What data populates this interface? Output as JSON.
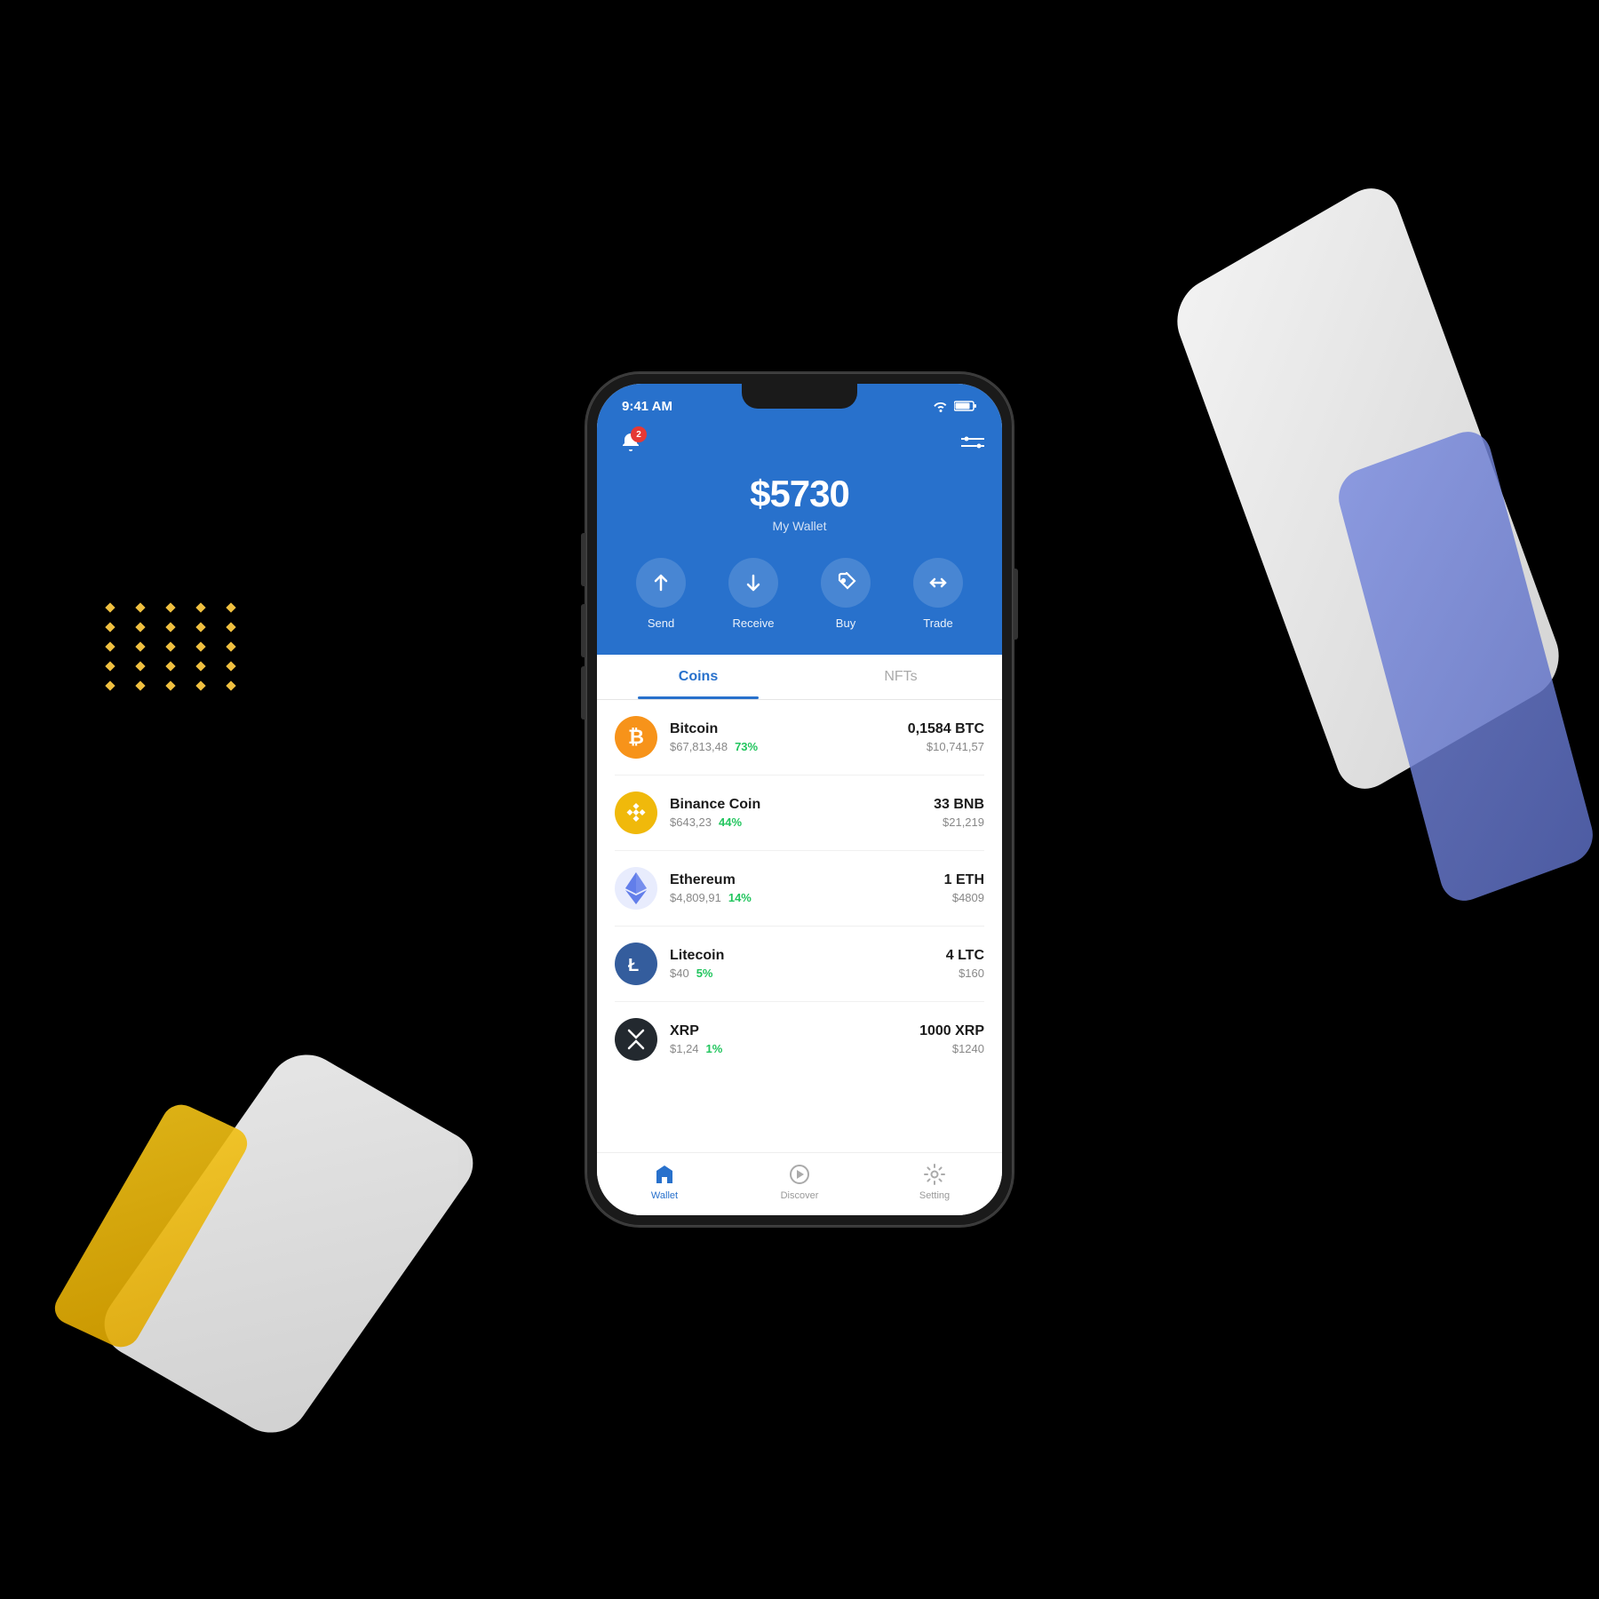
{
  "background": "#000000",
  "statusBar": {
    "time": "9:41 AM",
    "wifi": true,
    "battery": 75
  },
  "header": {
    "notificationCount": "2",
    "balance": "$5730",
    "walletLabel": "My Wallet",
    "actions": [
      {
        "id": "send",
        "label": "Send"
      },
      {
        "id": "receive",
        "label": "Receive"
      },
      {
        "id": "buy",
        "label": "Buy"
      },
      {
        "id": "trade",
        "label": "Trade"
      }
    ]
  },
  "tabs": [
    {
      "id": "coins",
      "label": "Coins",
      "active": true
    },
    {
      "id": "nfts",
      "label": "NFTs",
      "active": false
    }
  ],
  "coins": [
    {
      "id": "btc",
      "name": "Bitcoin",
      "price": "$67,813,48",
      "change": "73%",
      "amount": "0,1584 BTC",
      "value": "$10,741,57"
    },
    {
      "id": "bnb",
      "name": "Binance Coin",
      "price": "$643,23",
      "change": "44%",
      "amount": "33 BNB",
      "value": "$21,219"
    },
    {
      "id": "eth",
      "name": "Ethereum",
      "price": "$4,809,91",
      "change": "14%",
      "amount": "1 ETH",
      "value": "$4809"
    },
    {
      "id": "ltc",
      "name": "Litecoin",
      "price": "$40",
      "change": "5%",
      "amount": "4 LTC",
      "value": "$160"
    },
    {
      "id": "xrp",
      "name": "XRP",
      "price": "$1,24",
      "change": "1%",
      "amount": "1000 XRP",
      "value": "$1240"
    }
  ],
  "bottomNav": [
    {
      "id": "wallet",
      "label": "Wallet",
      "active": true
    },
    {
      "id": "discover",
      "label": "Discover",
      "active": false
    },
    {
      "id": "setting",
      "label": "Setting",
      "active": false
    }
  ]
}
